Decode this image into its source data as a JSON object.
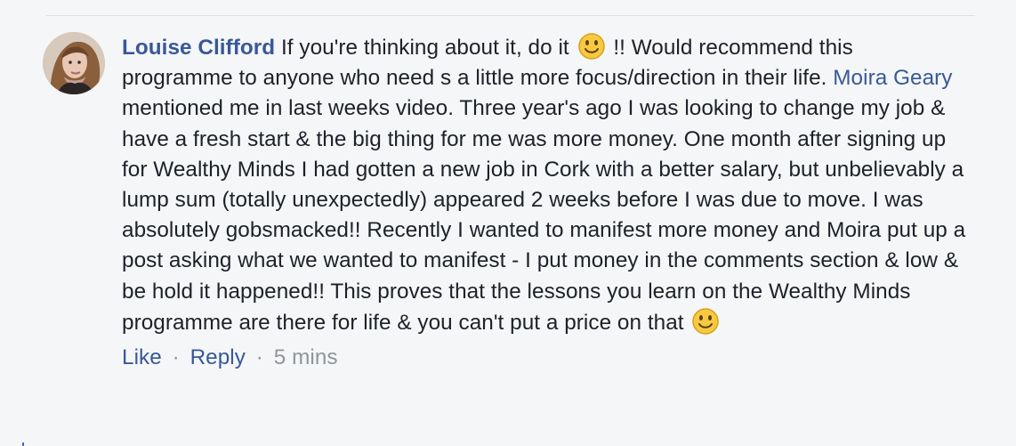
{
  "comment": {
    "author": "Louise Clifford",
    "text_1": "If you're thinking about it, do it",
    "text_2": "!! Would recommend this programme to anyone who need s a little more focus/direction in their life.",
    "mention": "Moira Geary",
    "text_3": "mentioned me in last weeks video. Three year's ago I was looking to change my job & have a fresh start & the big thing for me was more money. One month after signing up for Wealthy Minds I had gotten a new job in Cork with a better salary, but unbelievably a lump sum (totally unexpectedly) appeared 2 weeks before I was due to move. I was absolutely gobsmacked!! Recently I wanted to manifest more money and Moira put up a post asking what we wanted to manifest - I put money in the comments section & low & be hold it happened!! This proves that the lessons you learn on the Wealthy Minds programme are there for life & you can't put a price on that",
    "emoji_name": "smile-emoji"
  },
  "actions": {
    "like": "Like",
    "separator_1": "·",
    "reply": "Reply",
    "separator_2": "·",
    "time": "5 mins"
  },
  "colors": {
    "background": "#f5f6f7",
    "link": "#385898",
    "text": "#1d2129",
    "meta": "#90949c"
  }
}
